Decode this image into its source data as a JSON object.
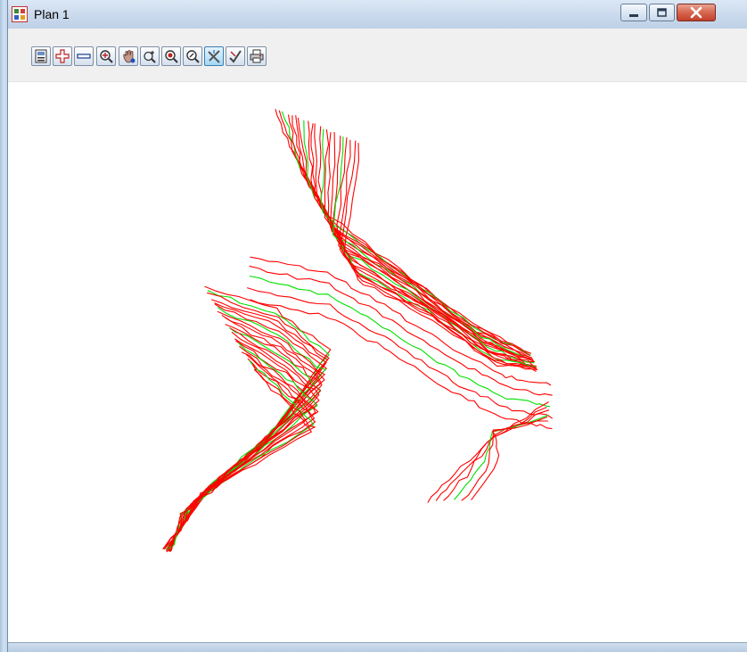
{
  "window": {
    "title": "Plan 1",
    "icon": "plan-view-icon",
    "controls": [
      "minimize-icon",
      "maximize-icon",
      "close-icon"
    ]
  },
  "toolbar": {
    "tools": [
      {
        "name": "plot-icon",
        "active": false
      },
      {
        "name": "zoom-in-plus-icon",
        "active": false
      },
      {
        "name": "zoom-out-minus-icon",
        "active": false
      },
      {
        "name": "zoom-window-icon",
        "active": false
      },
      {
        "name": "pan-hand-icon",
        "active": false
      },
      {
        "name": "zoom-plus-minus-icon",
        "active": false
      },
      {
        "name": "zoom-extent-icon",
        "active": false
      },
      {
        "name": "zoom-previous-icon",
        "active": false
      },
      {
        "name": "measure-cross-icon",
        "active": true
      },
      {
        "name": "pick-arrow-icon",
        "active": false
      },
      {
        "name": "print-icon",
        "active": false
      }
    ]
  },
  "plan": {
    "contour_colors": {
      "standard": "#ff0000",
      "major": "#00e000"
    },
    "background": "#ffffff"
  }
}
